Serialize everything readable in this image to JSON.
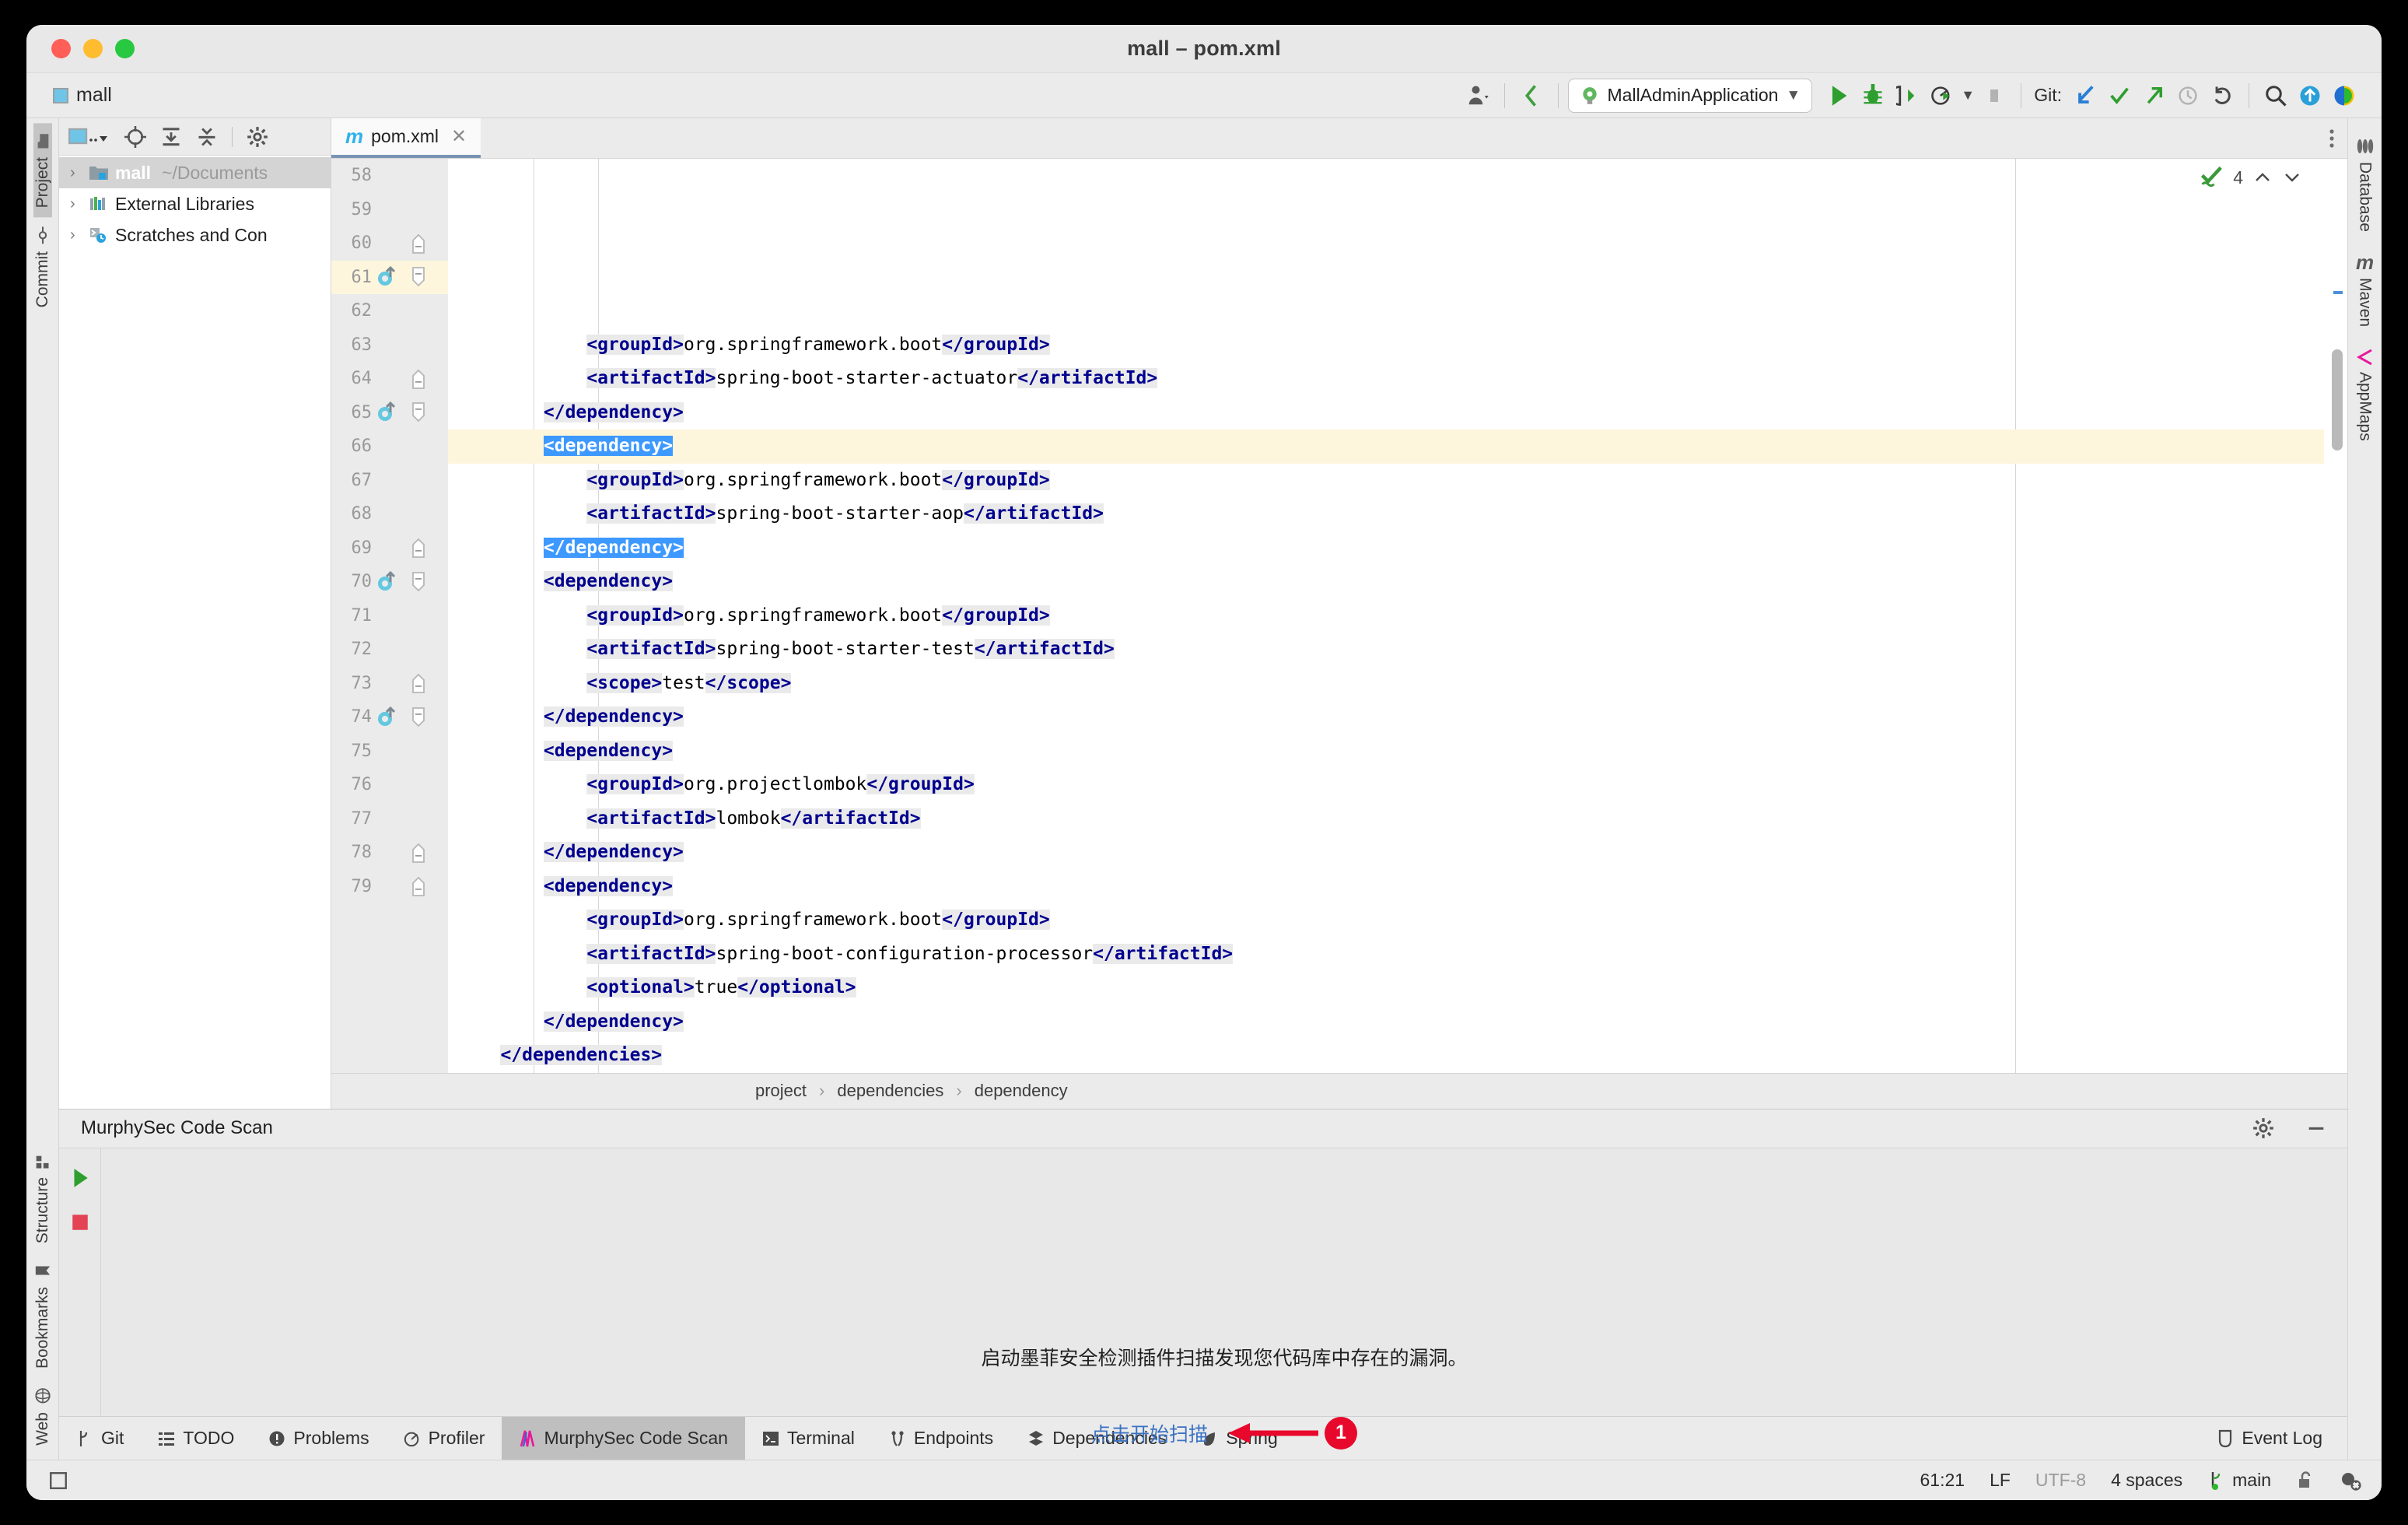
{
  "window": {
    "title": "mall – pom.xml",
    "traffic_lights": [
      "close",
      "minimize",
      "maximize"
    ]
  },
  "toolbar": {
    "project_label": "mall",
    "run_config": "MallAdminApplication",
    "git_label": "Git:",
    "buttons": [
      {
        "name": "profile-dropdown",
        "icon": "person-icon"
      },
      {
        "name": "back-navigation",
        "icon": "chevron-left-icon"
      },
      {
        "name": "run",
        "icon": "run-icon"
      },
      {
        "name": "debug",
        "icon": "debug-icon"
      },
      {
        "name": "run-with-coverage",
        "icon": "coverage-icon"
      },
      {
        "name": "profile",
        "icon": "profiler-icon"
      },
      {
        "name": "stop",
        "icon": "stop-icon"
      },
      {
        "name": "git-update",
        "icon": "git-pull-icon"
      },
      {
        "name": "git-commit",
        "icon": "checkmark-icon"
      },
      {
        "name": "git-push",
        "icon": "arrow-up-right-icon"
      },
      {
        "name": "git-history",
        "icon": "clock-icon"
      },
      {
        "name": "git-rollback",
        "icon": "undo-icon"
      },
      {
        "name": "search-everywhere",
        "icon": "search-icon"
      },
      {
        "name": "updates",
        "icon": "arrow-up-circle-icon"
      },
      {
        "name": "ide-feature",
        "icon": "rainbow-circle-icon"
      }
    ]
  },
  "left_rail": {
    "top_items": [
      {
        "label": "Project",
        "icon": "folder-icon",
        "active": true
      },
      {
        "label": "Commit",
        "icon": "commit-icon",
        "active": false
      }
    ],
    "bottom_items": [
      {
        "label": "Structure",
        "icon": "structure-icon"
      },
      {
        "label": "Bookmarks",
        "icon": "bookmark-icon"
      },
      {
        "label": "Web",
        "icon": "globe-icon"
      }
    ]
  },
  "right_rail": {
    "items": [
      {
        "label": "Database",
        "icon": "database-icon"
      },
      {
        "label": "Maven",
        "icon": "maven-m-icon"
      },
      {
        "label": "AppMaps",
        "icon": "appmaps-icon"
      }
    ]
  },
  "project_panel": {
    "toolbar_icons": [
      "project-view-dropdown-icon",
      "locate-icon",
      "expand-all-icon",
      "collapse-all-icon",
      "settings-gear-icon"
    ],
    "tree": [
      {
        "label": "mall",
        "path": "~/Documents",
        "bold": true,
        "selected": true,
        "icon": "module-folder-icon"
      },
      {
        "label": "External Libraries",
        "path": "",
        "bold": false,
        "selected": false,
        "icon": "libraries-icon"
      },
      {
        "label": "Scratches and Con",
        "path": "",
        "bold": false,
        "selected": false,
        "icon": "scratches-icon"
      }
    ]
  },
  "editor": {
    "tab": {
      "label": "pom.xml",
      "icon": "maven-m-icon",
      "close_icon": "close-icon"
    },
    "inspection": {
      "count": "4",
      "icon": "inspection-ok-icon"
    },
    "breadcrumb": [
      "project",
      "dependencies",
      "dependency"
    ],
    "first_line": 58,
    "lines": [
      {
        "n": 58,
        "indent": 3,
        "gutter": null,
        "fold": null,
        "parts": [
          {
            "t": "tag",
            "v": "<groupId>",
            "seg": true
          },
          {
            "t": "txt",
            "v": "org.springframework.boot"
          },
          {
            "t": "tag",
            "v": "</groupId>",
            "seg": true
          }
        ]
      },
      {
        "n": 59,
        "indent": 3,
        "gutter": null,
        "fold": null,
        "parts": [
          {
            "t": "tag",
            "v": "<artifactId>",
            "seg": true
          },
          {
            "t": "txt",
            "v": "spring-boot-starter-actuator"
          },
          {
            "t": "tag",
            "v": "</artifactId>",
            "seg": true
          }
        ]
      },
      {
        "n": 60,
        "indent": 2,
        "gutter": null,
        "fold": "end",
        "parts": [
          {
            "t": "tag",
            "v": "</dependency>",
            "seg": true
          }
        ]
      },
      {
        "n": 61,
        "indent": 2,
        "gutter": "maven-update",
        "fold": "start",
        "highlight": true,
        "parts": [
          {
            "t": "tag",
            "v": "<dependency>",
            "selected": true
          }
        ]
      },
      {
        "n": 62,
        "indent": 3,
        "gutter": null,
        "fold": null,
        "parts": [
          {
            "t": "tag",
            "v": "<groupId>",
            "seg": true
          },
          {
            "t": "txt",
            "v": "org.springframework.boot"
          },
          {
            "t": "tag",
            "v": "</groupId>",
            "seg": true
          }
        ]
      },
      {
        "n": 63,
        "indent": 3,
        "gutter": null,
        "fold": null,
        "parts": [
          {
            "t": "tag",
            "v": "<artifactId>",
            "seg": true
          },
          {
            "t": "txt",
            "v": "spring-boot-starter-aop"
          },
          {
            "t": "tag",
            "v": "</artifactId>",
            "seg": true
          }
        ]
      },
      {
        "n": 64,
        "indent": 2,
        "gutter": null,
        "fold": "end",
        "parts": [
          {
            "t": "tag",
            "v": "</dependency>",
            "selected": true
          }
        ]
      },
      {
        "n": 65,
        "indent": 2,
        "gutter": "maven-update",
        "fold": "start",
        "parts": [
          {
            "t": "tag",
            "v": "<dependency>",
            "seg": true
          }
        ]
      },
      {
        "n": 66,
        "indent": 3,
        "gutter": null,
        "fold": null,
        "parts": [
          {
            "t": "tag",
            "v": "<groupId>",
            "seg": true
          },
          {
            "t": "txt",
            "v": "org.springframework.boot"
          },
          {
            "t": "tag",
            "v": "</groupId>",
            "seg": true
          }
        ]
      },
      {
        "n": 67,
        "indent": 3,
        "gutter": null,
        "fold": null,
        "parts": [
          {
            "t": "tag",
            "v": "<artifactId>",
            "seg": true
          },
          {
            "t": "txt",
            "v": "spring-boot-starter-test"
          },
          {
            "t": "tag",
            "v": "</artifactId>",
            "seg": true
          }
        ]
      },
      {
        "n": 68,
        "indent": 3,
        "gutter": null,
        "fold": null,
        "parts": [
          {
            "t": "tag",
            "v": "<scope>",
            "seg": true
          },
          {
            "t": "txt",
            "v": "test"
          },
          {
            "t": "tag",
            "v": "</scope>",
            "seg": true
          }
        ]
      },
      {
        "n": 69,
        "indent": 2,
        "gutter": null,
        "fold": "end",
        "parts": [
          {
            "t": "tag",
            "v": "</dependency>",
            "seg": true
          }
        ]
      },
      {
        "n": 70,
        "indent": 2,
        "gutter": "maven-update",
        "fold": "start",
        "parts": [
          {
            "t": "tag",
            "v": "<dependency>",
            "seg": true
          }
        ]
      },
      {
        "n": 71,
        "indent": 3,
        "gutter": null,
        "fold": null,
        "parts": [
          {
            "t": "tag",
            "v": "<groupId>",
            "seg": true
          },
          {
            "t": "txt",
            "v": "org.projectlombok"
          },
          {
            "t": "tag",
            "v": "</groupId>",
            "seg": true
          }
        ]
      },
      {
        "n": 72,
        "indent": 3,
        "gutter": null,
        "fold": null,
        "parts": [
          {
            "t": "tag",
            "v": "<artifactId>",
            "seg": true
          },
          {
            "t": "txt",
            "v": "lombok"
          },
          {
            "t": "tag",
            "v": "</artifactId>",
            "seg": true
          }
        ]
      },
      {
        "n": 73,
        "indent": 2,
        "gutter": null,
        "fold": "end",
        "parts": [
          {
            "t": "tag",
            "v": "</dependency>",
            "seg": true
          }
        ]
      },
      {
        "n": 74,
        "indent": 2,
        "gutter": "maven-update",
        "fold": "start",
        "parts": [
          {
            "t": "tag",
            "v": "<dependency>",
            "seg": true
          }
        ]
      },
      {
        "n": 75,
        "indent": 3,
        "gutter": null,
        "fold": null,
        "parts": [
          {
            "t": "tag",
            "v": "<groupId>",
            "seg": true
          },
          {
            "t": "txt",
            "v": "org.springframework.boot"
          },
          {
            "t": "tag",
            "v": "</groupId>",
            "seg": true
          }
        ]
      },
      {
        "n": 76,
        "indent": 3,
        "gutter": null,
        "fold": null,
        "parts": [
          {
            "t": "tag",
            "v": "<artifactId>",
            "seg": true
          },
          {
            "t": "txt",
            "v": "spring-boot-configuration-processor"
          },
          {
            "t": "tag",
            "v": "</artifactId>",
            "seg": true
          }
        ]
      },
      {
        "n": 77,
        "indent": 3,
        "gutter": null,
        "fold": null,
        "parts": [
          {
            "t": "tag",
            "v": "<optional>",
            "seg": true
          },
          {
            "t": "txt",
            "v": "true"
          },
          {
            "t": "tag",
            "v": "</optional>",
            "seg": true
          }
        ]
      },
      {
        "n": 78,
        "indent": 2,
        "gutter": null,
        "fold": "end",
        "parts": [
          {
            "t": "tag",
            "v": "</dependency>",
            "seg": true
          }
        ]
      },
      {
        "n": 79,
        "indent": 1,
        "gutter": null,
        "fold": "end",
        "parts": [
          {
            "t": "tag",
            "v": "</dependencies>",
            "seg": true
          }
        ]
      }
    ]
  },
  "bottom_panel": {
    "title": "MurphySec Code Scan",
    "header_icons": [
      "settings-gear-icon",
      "minimize-icon"
    ],
    "actions": [
      {
        "name": "run-scan-button",
        "icon": "run-icon"
      },
      {
        "name": "stop-scan-button",
        "icon": "stop-icon"
      }
    ],
    "message": "启动墨菲安全检测插件扫描发现您代码库中存在的漏洞。",
    "link": "点击开始扫描",
    "annotation_badge": "1"
  },
  "tool_window_bar": {
    "items": [
      {
        "label": "Git",
        "icon": "git-branch-icon",
        "active": false
      },
      {
        "label": "TODO",
        "icon": "todo-list-icon",
        "active": false
      },
      {
        "label": "Problems",
        "icon": "problems-icon",
        "active": false
      },
      {
        "label": "Profiler",
        "icon": "profiler-icon",
        "active": false
      },
      {
        "label": "MurphySec Code Scan",
        "icon": "murphysec-icon",
        "active": true
      },
      {
        "label": "Terminal",
        "icon": "terminal-icon",
        "active": false
      },
      {
        "label": "Endpoints",
        "icon": "endpoints-icon",
        "active": false
      },
      {
        "label": "Dependencies",
        "icon": "dependencies-icon",
        "active": false
      },
      {
        "label": "Spring",
        "icon": "spring-leaf-icon",
        "active": false
      }
    ],
    "event_log": {
      "label": "Event Log",
      "icon": "event-log-icon"
    }
  },
  "status_bar": {
    "caret": "61:21",
    "line_separator": "LF",
    "encoding": "UTF-8",
    "indent": "4 spaces",
    "branch": "main",
    "icons": [
      "git-branch-icon",
      "unlock-icon",
      "inspection-mode-icon"
    ],
    "memory_icon": "memory-indicator-icon"
  },
  "colors": {
    "accent_blue": "#3d99ff",
    "tag_color": "#00008f",
    "highlight_line": "#fdf6dd",
    "badge_red": "#e8082b",
    "link_blue": "#3a72c4",
    "run_green": "#4aa54a"
  }
}
